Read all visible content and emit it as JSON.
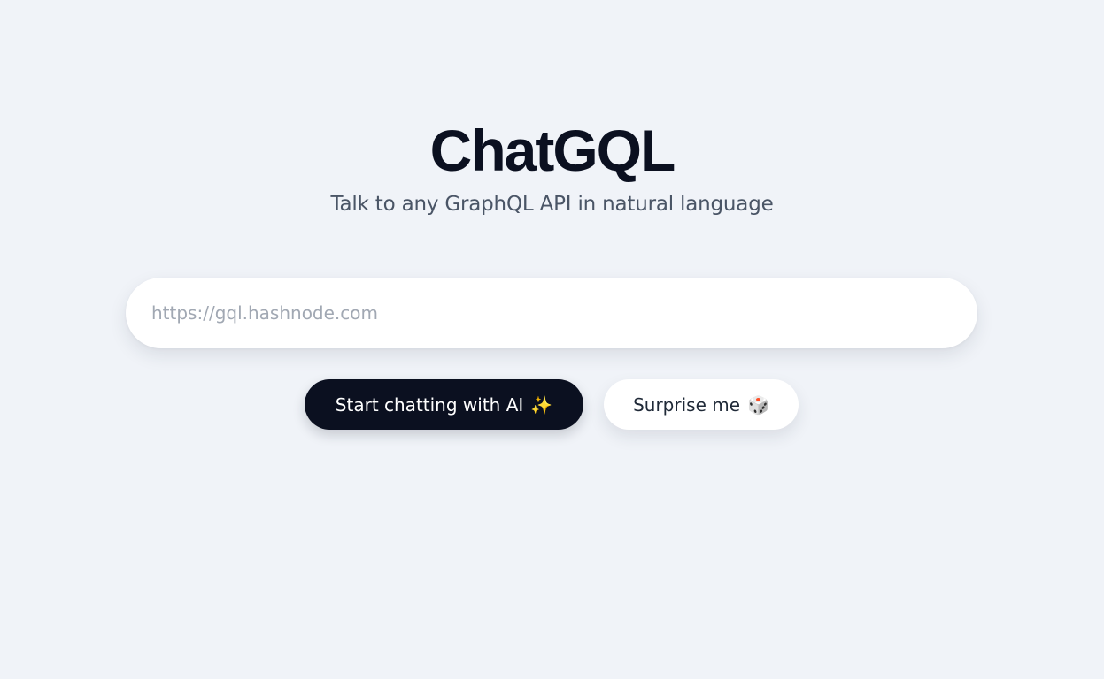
{
  "header": {
    "title": "ChatGQL",
    "subtitle": "Talk to any GraphQL API in natural language"
  },
  "form": {
    "url_placeholder": "https://gql.hashnode.com",
    "url_value": ""
  },
  "actions": {
    "start_label": "Start chatting with AI",
    "start_icon": "✨",
    "surprise_label": "Surprise me",
    "surprise_icon": "🎲"
  },
  "colors": {
    "background": "#f0f3f8",
    "primary_button": "#0b1020",
    "secondary_button": "#ffffff"
  }
}
